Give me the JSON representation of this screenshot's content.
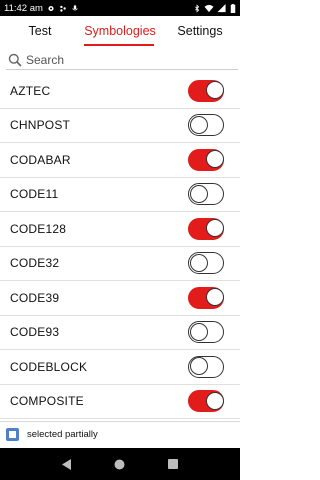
{
  "status_bar": {
    "time": "11:42 am",
    "icons": [
      "gear-icon",
      "dots-icon",
      "mic-icon",
      "bluetooth-icon",
      "wifi-icon",
      "signal-icon",
      "battery-icon"
    ]
  },
  "tabs": [
    {
      "label": "Test",
      "active": false
    },
    {
      "label": "Symbologies",
      "active": true
    },
    {
      "label": "Settings",
      "active": false
    }
  ],
  "search": {
    "placeholder": "Search",
    "value": ""
  },
  "symbologies": [
    {
      "label": "AZTEC",
      "enabled": true
    },
    {
      "label": "CHNPOST",
      "enabled": false
    },
    {
      "label": "CODABAR",
      "enabled": true
    },
    {
      "label": "CODE11",
      "enabled": false
    },
    {
      "label": "CODE128",
      "enabled": true
    },
    {
      "label": "CODE32",
      "enabled": false
    },
    {
      "label": "CODE39",
      "enabled": true
    },
    {
      "label": "CODE93",
      "enabled": false
    },
    {
      "label": "CODEBLOCK",
      "enabled": false
    },
    {
      "label": "COMPOSITE",
      "enabled": true
    }
  ],
  "selection_status": {
    "label": "selected partially"
  },
  "colors": {
    "accent": "#e21b1b",
    "checkbox": "#4f7fc9"
  }
}
